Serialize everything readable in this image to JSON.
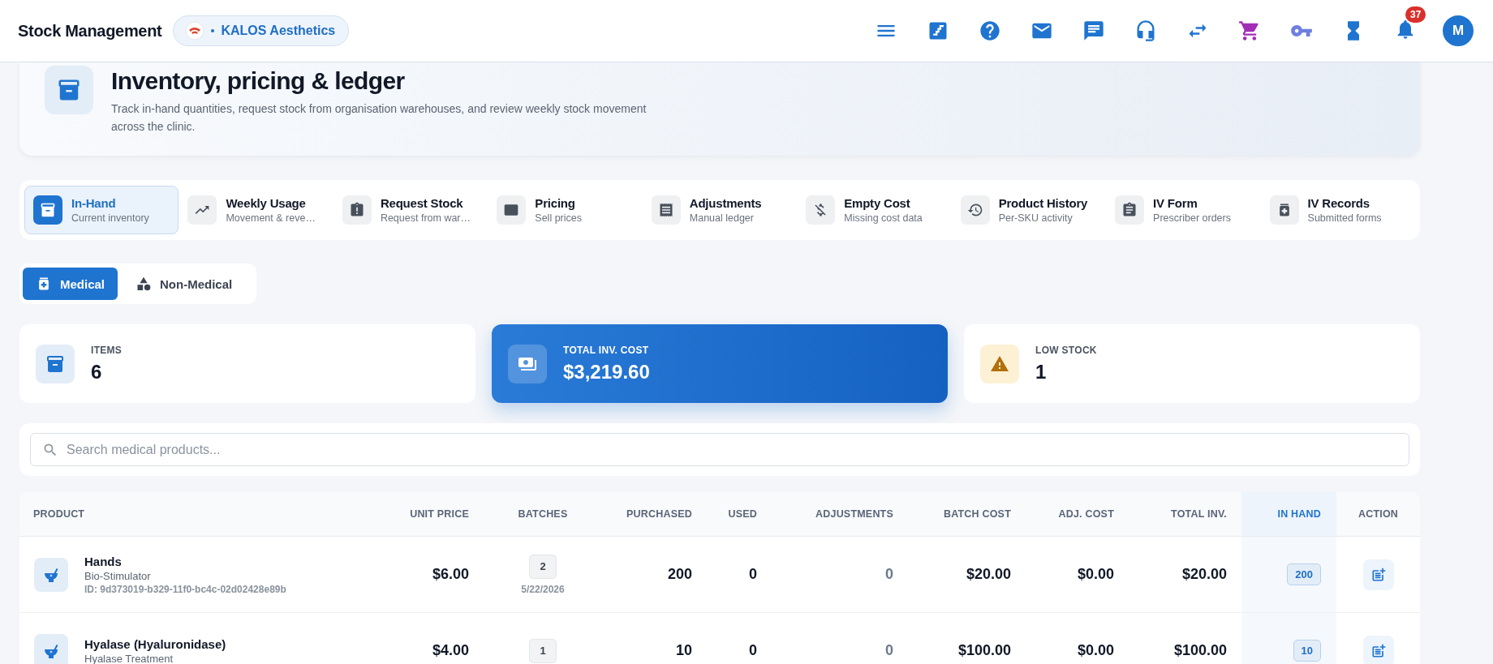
{
  "header": {
    "title": "Stock Management",
    "clinic": "KALOS Aesthetics",
    "notifications": "37",
    "avatar": "M"
  },
  "hero": {
    "title": "Inventory, pricing & ledger",
    "description": "Track in-hand quantities, request stock from organisation warehouses, and review weekly stock movement across the clinic."
  },
  "tabs": [
    {
      "label": "In-Hand",
      "sub": "Current inventory",
      "selected": true
    },
    {
      "label": "Weekly Usage",
      "sub": "Movement & reve…",
      "selected": false
    },
    {
      "label": "Request Stock",
      "sub": "Request from war…",
      "selected": false
    },
    {
      "label": "Pricing",
      "sub": "Sell prices",
      "selected": false
    },
    {
      "label": "Adjustments",
      "sub": "Manual ledger",
      "selected": false
    },
    {
      "label": "Empty Cost",
      "sub": "Missing cost data",
      "selected": false
    },
    {
      "label": "Product History",
      "sub": "Per-SKU activity",
      "selected": false
    },
    {
      "label": "IV Form",
      "sub": "Prescriber orders",
      "selected": false
    },
    {
      "label": "IV Records",
      "sub": "Submitted forms",
      "selected": false
    }
  ],
  "segments": [
    {
      "label": "Medical",
      "selected": true
    },
    {
      "label": "Non-Medical",
      "selected": false
    }
  ],
  "stats": [
    {
      "kind": "items",
      "label": "ITEMS",
      "value": "6"
    },
    {
      "kind": "cost",
      "label": "TOTAL INV. COST",
      "value": "$3,219.60"
    },
    {
      "kind": "low",
      "label": "LOW STOCK",
      "value": "1"
    }
  ],
  "search": {
    "placeholder": "Search medical products..."
  },
  "table": {
    "columns": [
      "PRODUCT",
      "UNIT PRICE",
      "BATCHES",
      "PURCHASED",
      "USED",
      "ADJUSTMENTS",
      "BATCH COST",
      "ADJ. COST",
      "TOTAL INV.",
      "IN HAND",
      "ACTION"
    ],
    "rows": [
      {
        "product": "Hands",
        "category": "Bio-Stimulator",
        "id": "ID: 9d373019-b329-11f0-bc4c-02d02428e89b",
        "unit_price": "$6.00",
        "batches": "2",
        "batch_date": "5/22/2026",
        "purchased": "200",
        "used": "0",
        "adjustments": "0",
        "batch_cost": "$20.00",
        "adj_cost": "$0.00",
        "total_inv": "$20.00",
        "in_hand": "200"
      },
      {
        "product": "Hyalase (Hyaluronidase)",
        "category": "Hyalase Treatment",
        "unit_price": "$4.00",
        "batches": "1",
        "purchased": "10",
        "used": "0",
        "adjustments": "0",
        "batch_cost": "$100.00",
        "adj_cost": "$0.00",
        "total_inv": "$100.00",
        "in_hand": "10"
      }
    ]
  }
}
